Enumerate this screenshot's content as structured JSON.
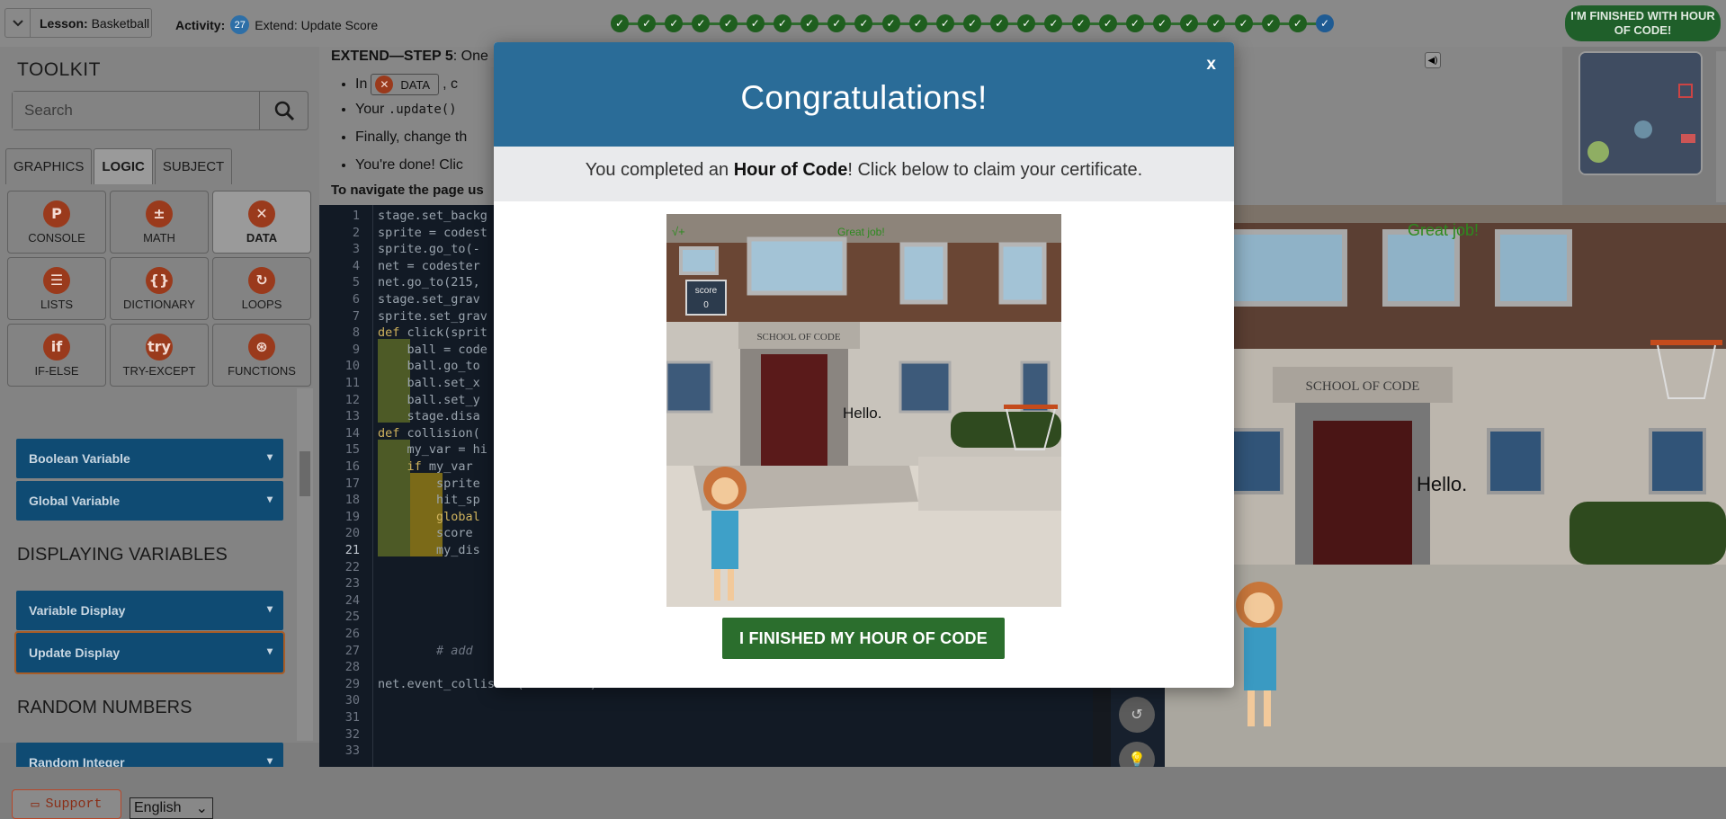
{
  "topbar": {
    "lesson_label": "Lesson:",
    "lesson_value": "Basketball",
    "activity_label": "Activity:",
    "activity_number": "27",
    "activity_title": "Extend: Update Score",
    "progress_completed": 26,
    "progress_current": 27,
    "finished_button": "I'M FINISHED WITH HOUR OF CODE!"
  },
  "toolkit": {
    "title": "TOOLKIT",
    "search_placeholder": "Search",
    "tabs": [
      "GRAPHICS",
      "LOGIC",
      "SUBJECT"
    ],
    "active_tab": "LOGIC",
    "categories": [
      {
        "label": "CONSOLE",
        "icon": "P"
      },
      {
        "label": "MATH",
        "icon": "±"
      },
      {
        "label": "DATA",
        "icon": "✕"
      },
      {
        "label": "LISTS",
        "icon": "☰"
      },
      {
        "label": "DICTIONARY",
        "icon": "{}"
      },
      {
        "label": "LOOPS",
        "icon": "↻"
      },
      {
        "label": "IF-ELSE",
        "icon": "if"
      },
      {
        "label": "TRY-EXCEPT",
        "icon": "try"
      },
      {
        "label": "FUNCTIONS",
        "icon": "⊛"
      }
    ],
    "items": {
      "boolean_variable": "Boolean Variable",
      "global_variable": "Global Variable",
      "displaying_heading": "DISPLAYING VARIABLES",
      "variable_display": "Variable Display",
      "update_display": "Update Display",
      "random_heading": "RANDOM NUMBERS",
      "random_integer": "Random Integer"
    }
  },
  "instructions": {
    "step_label": "EXTEND—STEP 5",
    "step_text": ": One",
    "bullet1_prefix": "In",
    "bullet1_chip": "DATA",
    "bullet1_suffix": ", c",
    "bullet2_prefix": "Your",
    "bullet2_code": ".update()",
    "bullet3": "Finally, change th",
    "bullet4": "You're done! Clic",
    "nav": "To navigate the page us"
  },
  "editor": {
    "line_count": 33,
    "current_line": 21,
    "lines": [
      "stage.set_backg",
      "sprite = codest",
      "sprite.go_to(-",
      "net = codester",
      "net.go_to(215,",
      "stage.set_grav",
      "sprite.set_grav",
      "def click(sprit",
      "    ball = code",
      "    ball.go_to",
      "    ball.set_x",
      "    ball.set_y",
      "    stage.disa",
      "def collision(",
      "    my_var = hi",
      "    if my_var",
      "        sprite",
      "        hit_sp",
      "        global",
      "        score",
      "        my_dis",
      "",
      "",
      "",
      "",
      "",
      "        # add",
      "",
      "net.event_collision(collision)",
      "",
      "",
      "",
      ""
    ]
  },
  "stage": {
    "great_job": "Great job!",
    "school_sign": "SCHOOL OF CODE",
    "hello": "Hello."
  },
  "modal": {
    "title": "Congratulations!",
    "close": "x",
    "subtitle_pre": "You completed an ",
    "subtitle_bold": "Hour of Code",
    "subtitle_post": "! Click below to claim your certificate.",
    "image": {
      "great_job": "Great job!",
      "score_label": "score",
      "score_value": "0",
      "school_sign": "SCHOOL OF CODE",
      "hello": "Hello.",
      "check_mark": "√+"
    },
    "button": "I FINISHED MY HOUR OF CODE"
  },
  "footer": {
    "support": "Support",
    "language": "English"
  },
  "colors": {
    "modal_header": "#2a6c98",
    "finish_button": "#2b6e2d",
    "toolkit_item": "#0f4b73"
  }
}
